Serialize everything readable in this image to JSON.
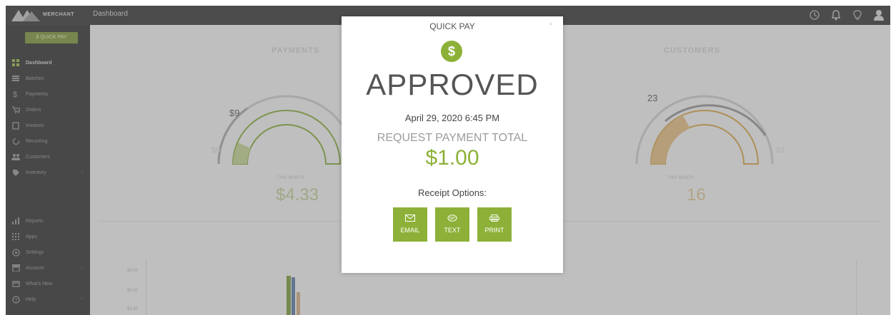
{
  "header": {
    "logo_text": "MERCHANT",
    "page_title": "Dashboard"
  },
  "top_icons": [
    "clock-icon",
    "bell-icon",
    "lightbulb-icon",
    "user-icon"
  ],
  "sidebar": {
    "quick_pay_label": "$ QUICK PAY",
    "items": [
      {
        "label": "Dashboard",
        "icon": "grid-icon",
        "active": true
      },
      {
        "label": "Batches",
        "icon": "list-icon"
      },
      {
        "label": "Payments",
        "icon": "dollar-icon"
      },
      {
        "label": "Orders",
        "icon": "cart-icon"
      },
      {
        "label": "Invoices",
        "icon": "document-icon"
      },
      {
        "label": "Recurring",
        "icon": "refresh-icon"
      },
      {
        "label": "Customers",
        "icon": "people-icon"
      },
      {
        "label": "Inventory",
        "icon": "tag-icon"
      },
      {
        "label": "Reports",
        "icon": "bar-chart-icon"
      },
      {
        "label": "Apps",
        "icon": "apps-icon"
      },
      {
        "label": "Settings",
        "icon": "gear-icon"
      },
      {
        "label": "Account",
        "icon": "store-icon"
      },
      {
        "label": "What's New",
        "icon": "calendar-icon"
      },
      {
        "label": "Help",
        "icon": "help-icon"
      }
    ]
  },
  "dashboard": {
    "payments": {
      "title": "PAYMENTS",
      "gauge_value": "$9",
      "min_value": "$0",
      "label": "THIS MONTH",
      "big_value": "$4.33"
    },
    "customers": {
      "title": "CUSTOMERS",
      "gauge_value": "23",
      "max_value": "83",
      "label": "THIS MONTH",
      "big_value": "16"
    },
    "chart_ticks": [
      "$3.00",
      "$3.00",
      "$2.50"
    ]
  },
  "modal": {
    "title": "QUICK PAY",
    "close": "×",
    "badge_symbol": "$",
    "status": "APPROVED",
    "datetime": "April 29, 2020 6:45 PM",
    "total_label": "REQUEST PAYMENT TOTAL",
    "amount": "$1.00",
    "receipt_label": "Receipt Options:",
    "buttons": [
      {
        "label": "EMAIL",
        "icon": "envelope-icon"
      },
      {
        "label": "TEXT",
        "icon": "chat-icon"
      },
      {
        "label": "PRINT",
        "icon": "printer-icon"
      }
    ]
  },
  "colors": {
    "accent_green": "#8db138",
    "gauge_orange": "#d9a441",
    "topbar": "#262626",
    "sidebar": "#1f1f1f"
  }
}
